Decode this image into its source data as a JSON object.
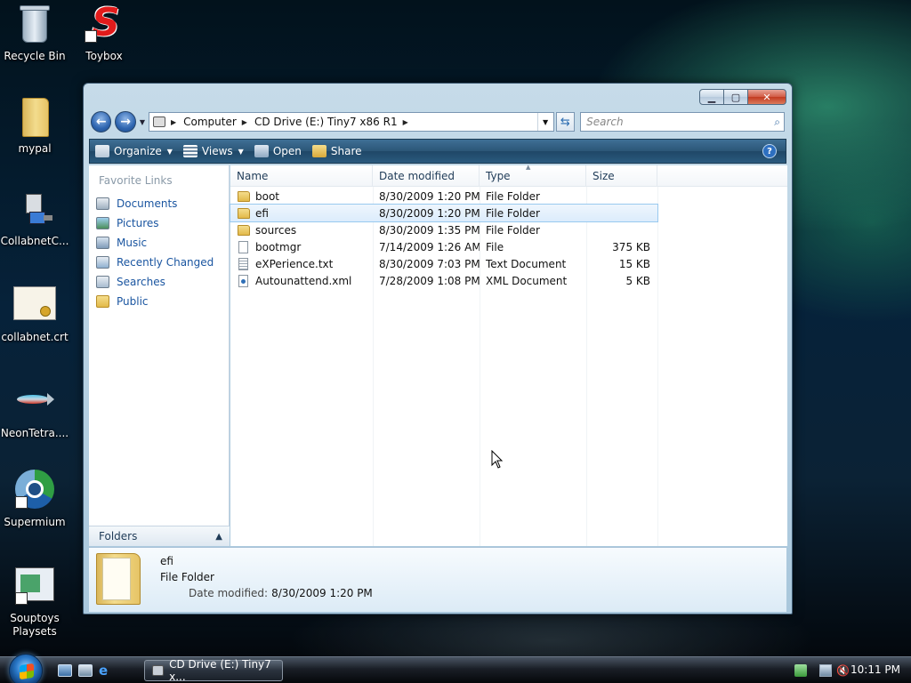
{
  "desktop": {
    "icons": [
      {
        "label": "Recycle Bin"
      },
      {
        "label": "Toybox"
      },
      {
        "label": "mypal"
      },
      {
        "label": "CollabnetC..."
      },
      {
        "label": "collabnet.crt"
      },
      {
        "label": "NeonTetra...."
      },
      {
        "label": "Supermium"
      },
      {
        "label": "Souptoys Playsets"
      }
    ]
  },
  "window": {
    "address": {
      "segments": [
        "Computer",
        "CD Drive (E:) Tiny7 x86 R1"
      ]
    },
    "search": {
      "placeholder": "Search"
    },
    "toolbar": {
      "organize": "Organize",
      "views": "Views",
      "open": "Open",
      "share": "Share"
    },
    "favorites": {
      "title": "Favorite Links",
      "items": [
        {
          "label": "Documents"
        },
        {
          "label": "Pictures"
        },
        {
          "label": "Music"
        },
        {
          "label": "Recently Changed"
        },
        {
          "label": "Searches"
        },
        {
          "label": "Public"
        }
      ]
    },
    "folders_label": "Folders",
    "columns": {
      "name": "Name",
      "date": "Date modified",
      "type": "Type",
      "size": "Size"
    },
    "files": [
      {
        "name": "boot",
        "date": "8/30/2009 1:20 PM",
        "type": "File Folder",
        "size": "",
        "icon": "folder-icon"
      },
      {
        "name": "efi",
        "date": "8/30/2009 1:20 PM",
        "type": "File Folder",
        "size": "",
        "icon": "folder-icon",
        "selected": true
      },
      {
        "name": "sources",
        "date": "8/30/2009 1:35 PM",
        "type": "File Folder",
        "size": "",
        "icon": "folder-icon"
      },
      {
        "name": "bootmgr",
        "date": "7/14/2009 1:26 AM",
        "type": "File",
        "size": "375 KB",
        "icon": "file-icon"
      },
      {
        "name": "eXPerience.txt",
        "date": "8/30/2009 7:03 PM",
        "type": "Text Document",
        "size": "15 KB",
        "icon": "text-file-icon"
      },
      {
        "name": "Autounattend.xml",
        "date": "7/28/2009 1:08 PM",
        "type": "XML Document",
        "size": "5 KB",
        "icon": "xml-file-icon"
      }
    ],
    "details": {
      "name": "efi",
      "type": "File Folder",
      "modified_label": "Date modified:",
      "modified_value": "8/30/2009 1:20 PM"
    }
  },
  "taskbar": {
    "task_label": "CD Drive (E:) Tiny7 x...",
    "clock": "10:11 PM"
  }
}
